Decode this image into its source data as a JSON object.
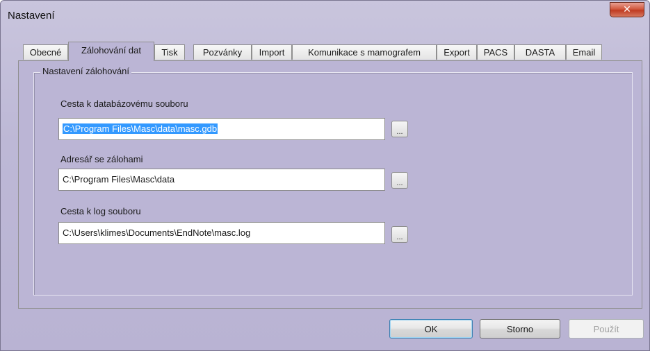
{
  "window": {
    "title": "Nastavení",
    "close_glyph": "✕"
  },
  "tabs": [
    {
      "label": "Obecné",
      "active": false
    },
    {
      "label": "Zálohování dat",
      "active": true
    },
    {
      "label": "Tisk",
      "active": false
    },
    {
      "label": "Pozvánky",
      "active": false
    },
    {
      "label": "Import",
      "active": false
    },
    {
      "label": "Komunikace s mamografem",
      "active": false
    },
    {
      "label": "Export",
      "active": false
    },
    {
      "label": "PACS",
      "active": false
    },
    {
      "label": "DASTA",
      "active": false
    },
    {
      "label": "Email",
      "active": false
    }
  ],
  "group": {
    "title": "Nastavení zálohování",
    "fields": [
      {
        "label": "Cesta k databázovému souboru",
        "value": "C:\\Program Files\\Masc\\data\\masc.gdb",
        "selected": true
      },
      {
        "label": "Adresář se zálohami",
        "value": "C:\\Program Files\\Masc\\data",
        "selected": false
      },
      {
        "label": "Cesta k log souboru",
        "value": "C:\\Users\\klimes\\Documents\\EndNote\\masc.log",
        "selected": false
      }
    ],
    "browse_label": "..."
  },
  "buttons": {
    "ok": "OK",
    "cancel": "Storno",
    "apply": "Použít"
  },
  "colors": {
    "panel": "#bbb5d5",
    "selection": "#3399ff",
    "close": "#c03b22"
  }
}
